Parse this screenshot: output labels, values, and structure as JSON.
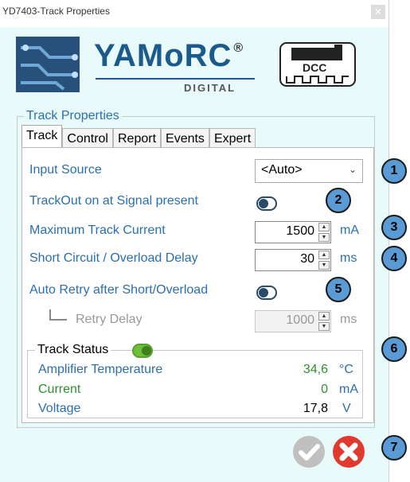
{
  "window": {
    "title": "YD7403-Track Properties",
    "close_glyph": "✕"
  },
  "brand": {
    "name": "YAMoRC",
    "registered": "®",
    "sub": "DIGITAL",
    "logo_icon": "circuit-board-icon",
    "dcc_icon": "dcc-locomotive-icon",
    "dcc_text": "DCC"
  },
  "group_title": "Track Properties",
  "tabs": [
    "Track",
    "Control",
    "Report",
    "Events",
    "Expert"
  ],
  "active_tab": "Track",
  "settings": {
    "input_source": {
      "label": "Input Source",
      "value": "<Auto>"
    },
    "trackout_signal": {
      "label": "TrackOut on at Signal present",
      "on": false
    },
    "max_current": {
      "label": "Maximum Track Current",
      "value": "1500",
      "unit": "mA"
    },
    "short_delay": {
      "label": "Short Circuit / Overload Delay",
      "value": "30",
      "unit": "ms"
    },
    "auto_retry": {
      "label": "Auto Retry after Short/Overload",
      "on": false
    },
    "retry_delay": {
      "label": "Retry Delay",
      "value": "1000",
      "unit": "ms",
      "enabled": false
    }
  },
  "status": {
    "title": "Track Status",
    "on": true,
    "rows": [
      {
        "label": "Amplifier Temperature",
        "value": "34,6",
        "unit": "°C"
      },
      {
        "label": "Current",
        "value": "0",
        "unit": "mA"
      },
      {
        "label": "Voltage",
        "value": "17,8",
        "unit": "V"
      }
    ]
  },
  "buttons": {
    "ok_icon": "check-icon",
    "cancel_icon": "cancel-icon"
  },
  "callouts": [
    "1",
    "2",
    "3",
    "4",
    "5",
    "6",
    "7"
  ],
  "colors": {
    "label_blue": "#2a6fb0",
    "value_green": "#2f8f2f",
    "callout_fill": "#5b9bd5",
    "cancel_red": "#e03a2e"
  }
}
